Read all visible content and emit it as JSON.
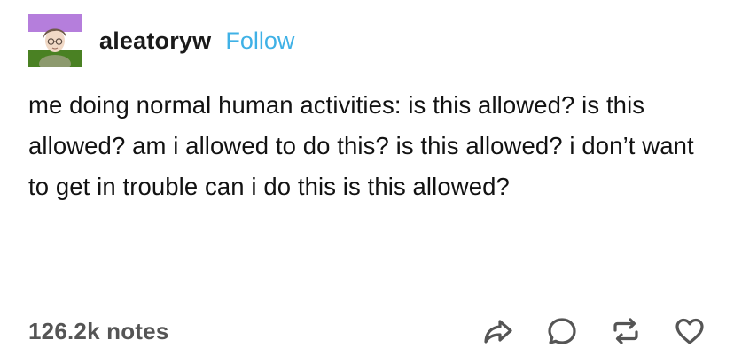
{
  "post": {
    "username": "aleatoryw",
    "follow_label": "Follow",
    "body": "me doing normal human activities: is this allowed? is this allowed? am i allowed to do this? is this allowed? i don’t want to get in trouble can i do this is this allowed?",
    "notes": "126.2k notes"
  },
  "colors": {
    "follow": "#3fb1e6",
    "icon_stroke": "#555555"
  },
  "icons": {
    "share": "share-icon",
    "reply": "reply-icon",
    "reblog": "reblog-icon",
    "like": "heart-icon"
  }
}
